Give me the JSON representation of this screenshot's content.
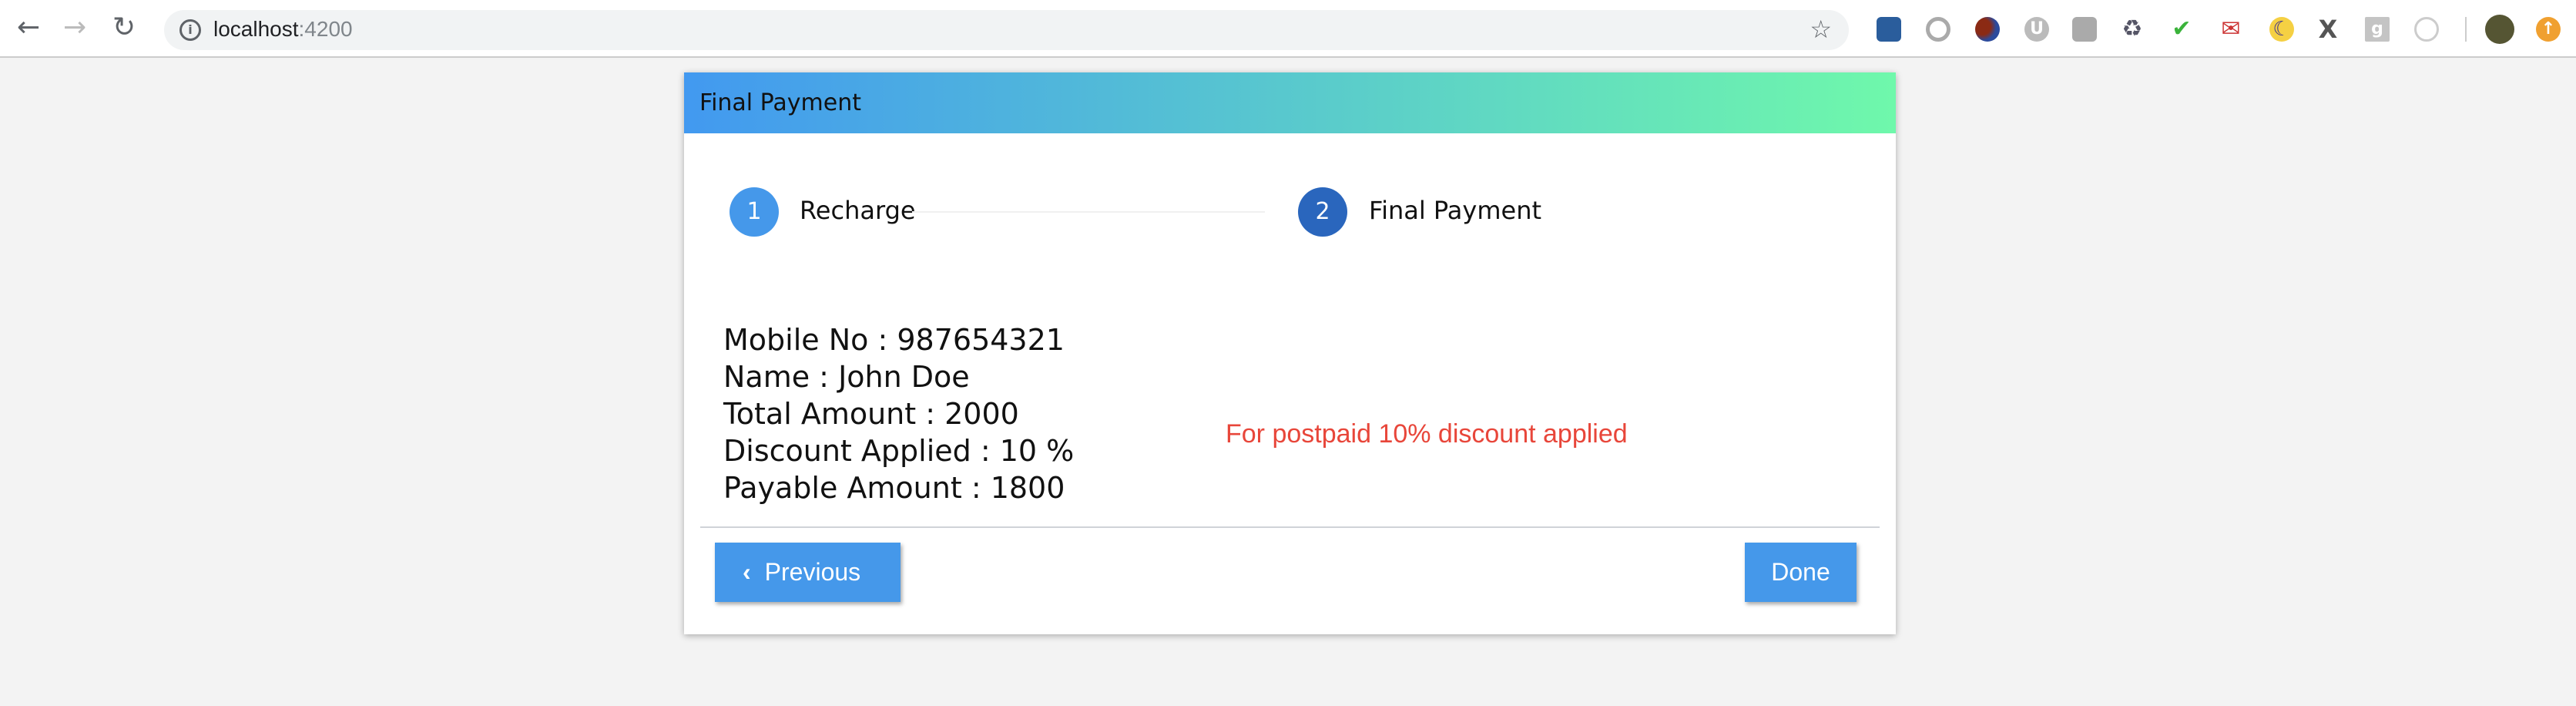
{
  "browser": {
    "url_host": "localhost",
    "url_port": ":4200",
    "extensions": [
      "cookie-inspector",
      "circle-ext",
      "balls-ext",
      "u-ext",
      "mail-ext",
      "recycle-ext",
      "abc-check-ext",
      "red-mail-ext",
      "moon-ext",
      "x-ext",
      "g-ext",
      "target-ext"
    ]
  },
  "card": {
    "title": "Final Payment",
    "steps": [
      {
        "number": "1",
        "label": "Recharge"
      },
      {
        "number": "2",
        "label": "Final Payment"
      }
    ],
    "details": [
      "Mobile No : 987654321",
      "Name : John Doe",
      "Total Amount : 2000",
      "Discount Applied : 10 %",
      "Payable Amount : 1800"
    ],
    "note": "For postpaid 10% discount applied",
    "previous_label": "Previous",
    "done_label": "Done"
  },
  "colors": {
    "step_active": "#2a66bd",
    "step_done": "#4598ea",
    "note": "#e8463a",
    "button": "#4598ea"
  }
}
